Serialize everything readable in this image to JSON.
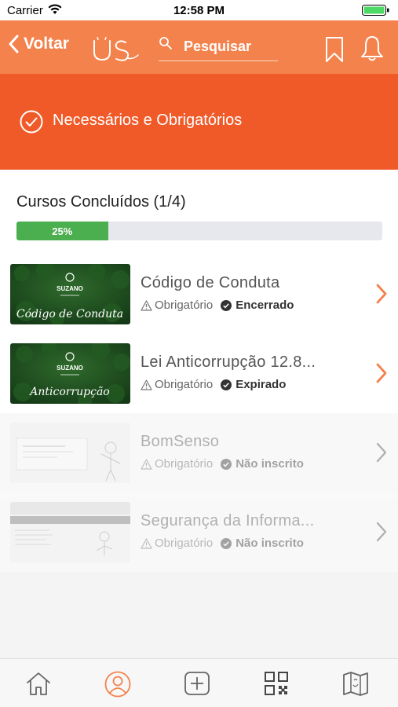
{
  "status_bar": {
    "carrier": "Carrier",
    "time": "12:58 PM"
  },
  "nav": {
    "back_label": "Voltar",
    "search_placeholder": "Pesquisar"
  },
  "banner": {
    "title": "Necessários e Obrigatórios"
  },
  "progress": {
    "title": "Cursos Concluídos (1/4)",
    "percent_label": "25%",
    "fraction": 0.25
  },
  "courses": [
    {
      "title": "Código de Conduta",
      "tag": "Obrigatório",
      "status": "Encerrado",
      "thumb_text": "Código de Conduta",
      "brand": "SUZANO"
    },
    {
      "title": "Lei Anticorrupção 12.8...",
      "tag": "Obrigatório",
      "status": "Expirado",
      "thumb_text": "Anticorrupção",
      "brand": "SUZANO"
    },
    {
      "title": "BomSenso",
      "tag": "Obrigatório",
      "status": "Não inscrito"
    },
    {
      "title": "Segurança da Informa...",
      "tag": "Obrigatório",
      "status": "Não inscrito"
    }
  ],
  "colors": {
    "accent": "#f3824c",
    "banner": "#f05a28",
    "progress": "#4bae4f"
  },
  "tabs": [
    "home-icon",
    "profile-icon",
    "add-icon",
    "qr-code-icon",
    "map-icon"
  ]
}
